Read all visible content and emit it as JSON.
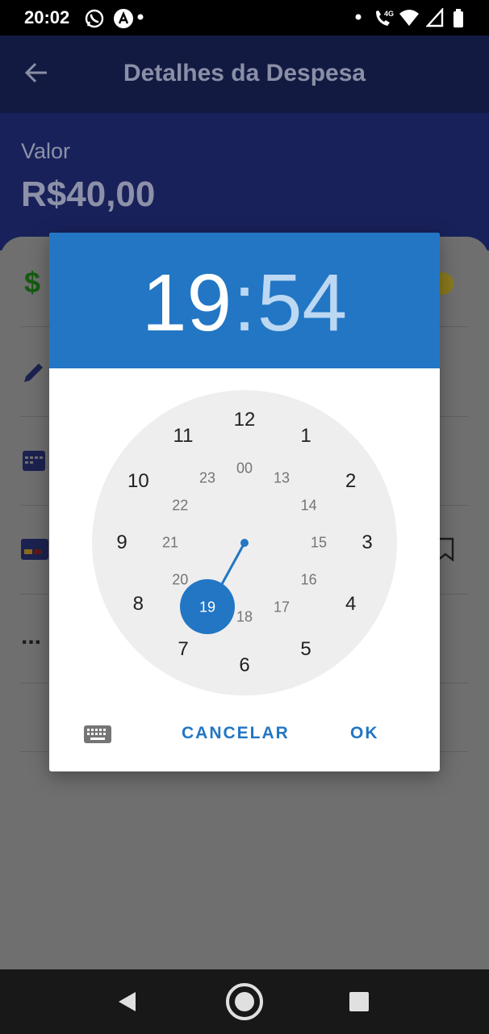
{
  "status_bar": {
    "time": "20:02",
    "icons": [
      "whatsapp-icon",
      "notification-a-icon",
      "dot-icon",
      "dot-icon",
      "wifi-call-icon",
      "wifi-icon",
      "signal-icon",
      "battery-icon"
    ],
    "network_label": "4G"
  },
  "app": {
    "title": "Detalhes da Despesa",
    "value_label": "Valor",
    "value_amount": "R$40,00",
    "row_icons": [
      "dollar-icon",
      "pencil-icon",
      "calendar-icon",
      "credit-card-icon",
      "more-dots-icon"
    ],
    "dollar_symbol": "$",
    "more_dots": "..."
  },
  "dialog": {
    "hour": "19",
    "separator": ":",
    "minute": "54",
    "outer_numbers": [
      "12",
      "1",
      "2",
      "3",
      "4",
      "5",
      "6",
      "7",
      "8",
      "9",
      "10",
      "11"
    ],
    "inner_numbers": [
      "00",
      "13",
      "14",
      "15",
      "16",
      "17",
      "18",
      "19",
      "20",
      "21",
      "22",
      "23"
    ],
    "selected_hour": "19",
    "cancel_label": "CANCELAR",
    "ok_label": "OK"
  },
  "colors": {
    "accent": "#2276c4",
    "clock_face": "#eeeeee",
    "minute_color": "#bcd8f3"
  }
}
